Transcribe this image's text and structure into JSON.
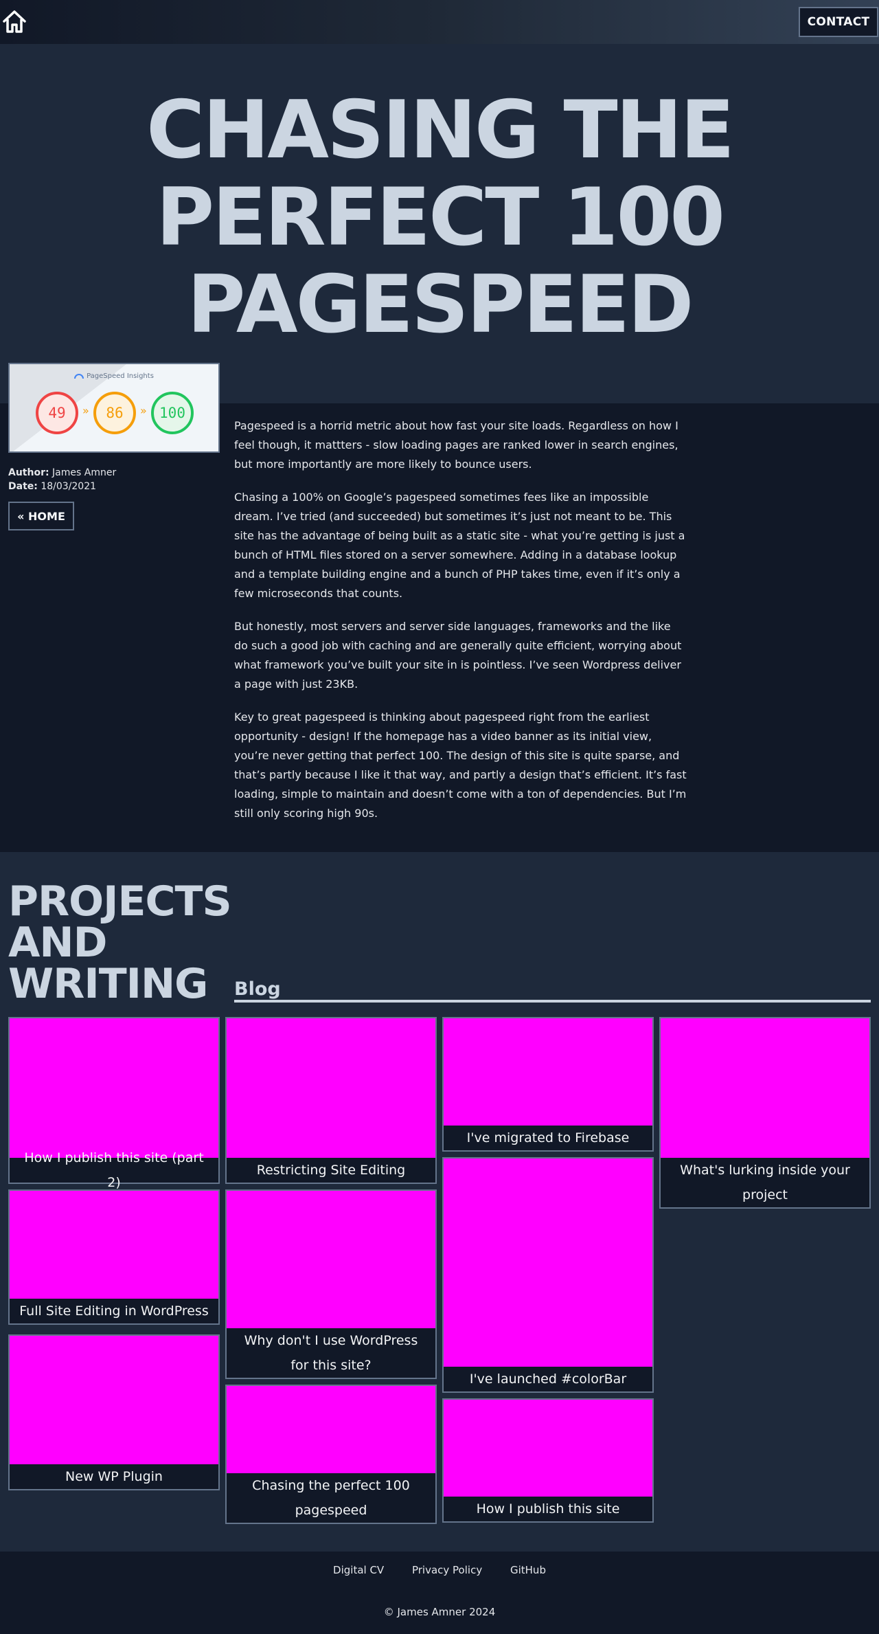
{
  "header": {
    "home_icon": "home-icon",
    "contact_label": "CONTACT"
  },
  "hero": {
    "title_line1": "CHASING THE",
    "title_line2": "PERFECT 100",
    "title_line3": "PAGESPEED"
  },
  "thumbnail": {
    "heading": "PageSpeed Insights",
    "scores": [
      "49",
      "86",
      "100"
    ],
    "arrow": "»"
  },
  "meta": {
    "author_label": "Author:",
    "author": "James Amner",
    "date_label": "Date:",
    "date": "18/03/2021",
    "back_label": "« HOME"
  },
  "article": {
    "paragraphs": [
      "Pagespeed is a horrid metric about how fast your site loads. Regardless on how I feel though, it mattters - slow loading pages are ranked lower in search engines, but more importantly are more likely to bounce users.",
      "Chasing a 100% on Google’s pagespeed sometimes fees like an impossible dream. I’ve tried (and succeeded) but sometimes it’s just not meant to be. This site has the advantage of being built as a static site - what you’re getting is just a bunch of HTML files stored on a server somewhere. Adding in a database lookup and a template building engine and a bunch of PHP takes time, even if it’s only a few microseconds that counts.",
      "But honestly, most servers and server side languages, frameworks and the like do such a good job with caching and are generally quite efficient, worrying about what framework you’ve built your site in is pointless. I’ve seen Wordpress deliver a page with just 23KB.",
      "Key to great pagespeed is thinking about pagespeed right from the earliest opportunity - design! If the homepage has a video banner as its initial view, you’re never getting that perfect 100. The design of this site is quite sparse, and that’s partly because I like it that way, and partly a design that’s efficient. It’s fast loading, simple to maintain and doesn’t come with a ton of dependencies. But I’m still only scoring high 90s."
    ]
  },
  "projects": {
    "title": "PROJECTS AND WRITING",
    "blog_heading": "Blog",
    "cards": [
      "How I publish this site (part 2)",
      "Restricting Site Editing",
      "I've migrated to Firebase",
      "What's lurking inside your project",
      "Full Site Editing in WordPress",
      "Why don't I use WordPress for this site?",
      "I've launched #colorBar",
      "New WP Plugin",
      "Chasing the perfect 100 pagespeed",
      "How I publish this site"
    ]
  },
  "footer": {
    "links": [
      "Digital CV",
      "Privacy Policy",
      "GitHub"
    ],
    "copyright": "© James Amner 2024"
  },
  "colors": {
    "background": "#111827",
    "panel": "#1e293b",
    "heading": "#cbd5e1",
    "placeholder": "#ff00ff",
    "border": "#64748b"
  }
}
